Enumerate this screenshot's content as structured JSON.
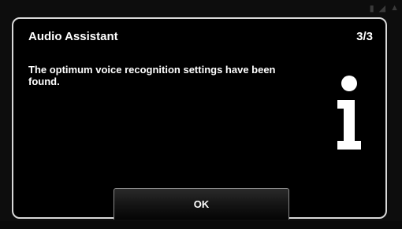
{
  "dialog": {
    "title": "Audio Assistant",
    "counter": "3/3",
    "message": "The optimum voice recognition settings have been found.",
    "icon": "info-icon",
    "ok_label": "OK"
  },
  "status_bar": {
    "icons": [
      "status-icon",
      "signal-icon",
      "alert-icon"
    ]
  },
  "colors": {
    "background": "#000000",
    "border": "#d9d9d9",
    "text": "#ffffff"
  }
}
